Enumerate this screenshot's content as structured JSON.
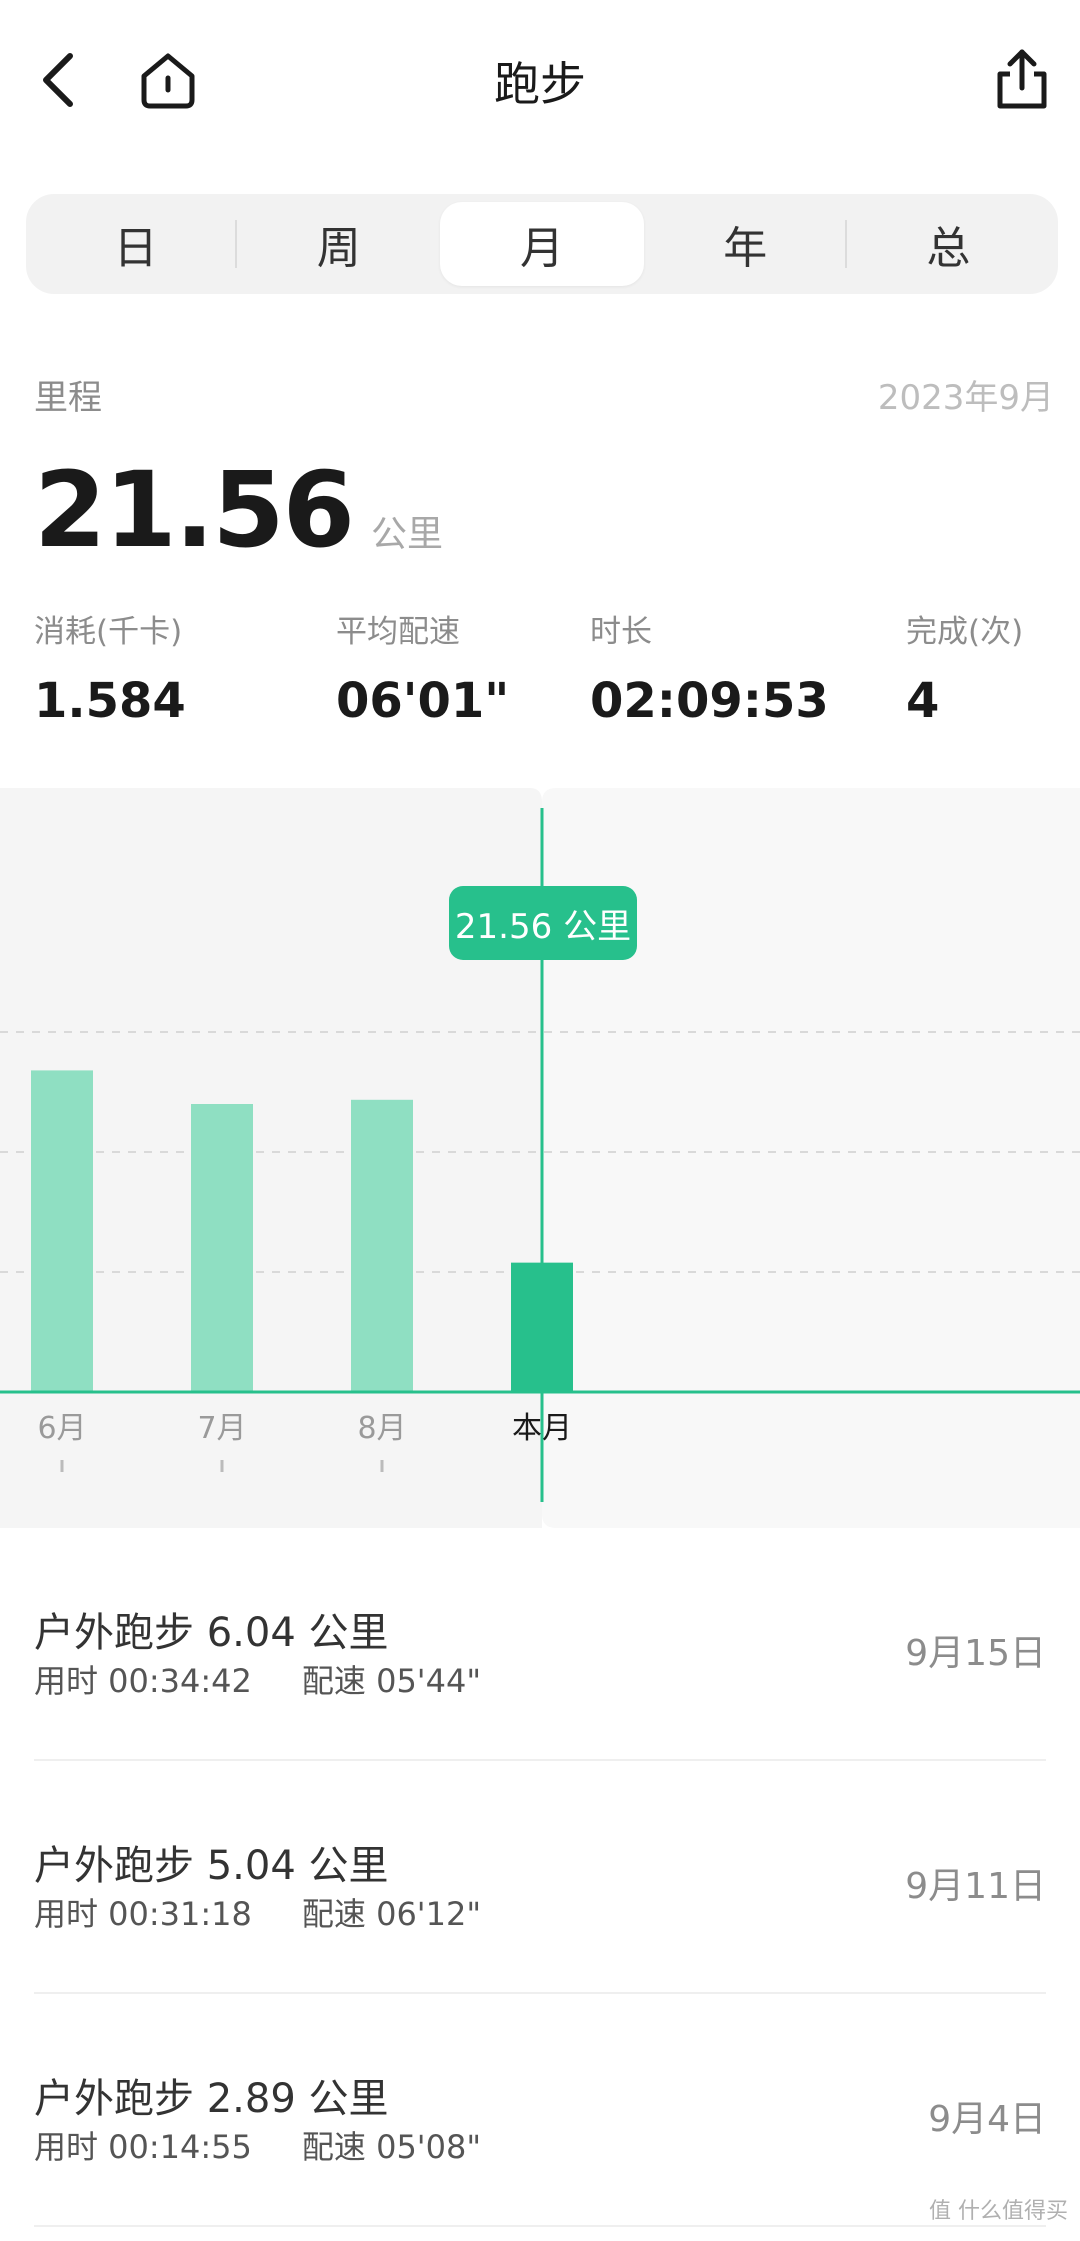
{
  "header": {
    "title": "跑步"
  },
  "tabs": [
    {
      "label": "日",
      "active": false
    },
    {
      "label": "周",
      "active": false
    },
    {
      "label": "月",
      "active": true
    },
    {
      "label": "年",
      "active": false
    },
    {
      "label": "总",
      "active": false
    }
  ],
  "summary": {
    "label": "里程",
    "date": "2023年9月",
    "distance": "21.56",
    "unit": "公里"
  },
  "stats": [
    {
      "label": "消耗(千卡)",
      "value": "1.584"
    },
    {
      "label": "平均配速",
      "value": "06'01\""
    },
    {
      "label": "时长",
      "value": "02:09:53"
    },
    {
      "label": "完成(次)",
      "value": "4"
    }
  ],
  "chart": {
    "tooltip": "21.56 公里",
    "accent_color": "#27c08c",
    "bar_color": "#8fdfc2"
  },
  "chart_data": {
    "type": "bar",
    "categories": [
      "6月",
      "7月",
      "8月",
      "本月"
    ],
    "values": [
      53.6,
      48.0,
      48.7,
      21.56
    ],
    "selected_index": 3,
    "ylim": [
      0,
      80
    ],
    "grid": true
  },
  "records": [
    {
      "title": "户外跑步 6.04 公里",
      "duration": "用时 00:34:42",
      "pace": "配速 05'44\"",
      "date": "9月15日"
    },
    {
      "title": "户外跑步 5.04 公里",
      "duration": "用时 00:31:18",
      "pace": "配速 06'12\"",
      "date": "9月11日"
    },
    {
      "title": "户外跑步 2.89 公里",
      "duration": "用时 00:14:55",
      "pace": "配速 05'08\"",
      "date": "9月4日"
    }
  ],
  "watermark": "值 什么值得买"
}
